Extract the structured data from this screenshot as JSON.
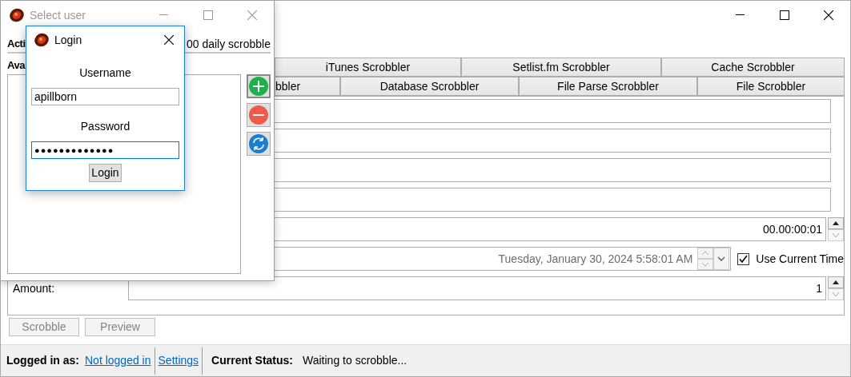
{
  "main_window": {
    "tabs_row1": [
      {
        "label": "iTunes Scrobbler",
        "selected": false
      },
      {
        "label": "Setlist.fm Scrobbler",
        "selected": false
      },
      {
        "label": "Cache Scrobbler",
        "selected": false
      }
    ],
    "tabs_row2": [
      {
        "label": "bbler",
        "selected": false
      },
      {
        "label": "Database Scrobbler",
        "selected": false
      },
      {
        "label": "File Parse Scrobbler",
        "selected": false
      },
      {
        "label": "File Scrobbler",
        "selected": false
      }
    ],
    "fields": [
      {
        "kind": "text"
      },
      {
        "kind": "text"
      },
      {
        "kind": "text"
      },
      {
        "kind": "text"
      },
      {
        "kind": "timespan",
        "value": "00.00:00:01"
      },
      {
        "kind": "datetime",
        "value": "Tuesday, January 30, 2024 5:58:01 AM",
        "checkbox": {
          "label": "Use Current Time",
          "checked": true
        }
      },
      {
        "kind": "number",
        "label": "Amount:",
        "value": "1"
      }
    ],
    "buttons": [
      {
        "label": "Scrobble",
        "disabled": true
      },
      {
        "label": "Preview",
        "disabled": true
      }
    ],
    "status_bar": {
      "logged_in_label": "Logged in as:",
      "user_link": "Not logged in",
      "settings_link": "Settings",
      "status_label": "Current Status:",
      "status_text": "Waiting to scrobble..."
    }
  },
  "select_user_window": {
    "title": "Select user",
    "active": false,
    "header_left": "Acti",
    "header_right": "00 daily scrobble",
    "list_label": "Ava"
  },
  "login_dialog": {
    "title": "Login",
    "active": true,
    "username_label": "Username",
    "username": "apillborn",
    "password_label": "Password",
    "password": "●●●●●●●●●●●●●",
    "button": "Login"
  }
}
